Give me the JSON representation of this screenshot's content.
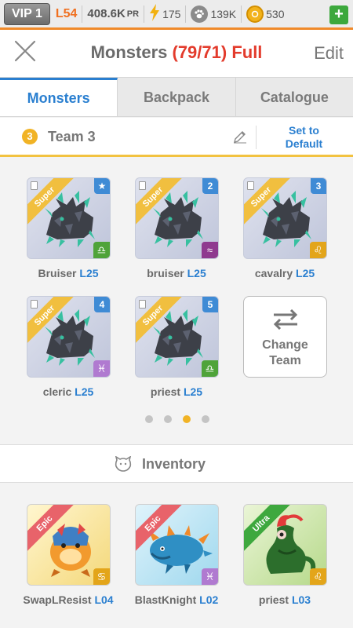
{
  "statusbar": {
    "vip": "VIP 1",
    "level": "L54",
    "power": "408.6K",
    "power_unit": "PR",
    "energy": "175",
    "food": "139K",
    "coins": "530",
    "plus": "+"
  },
  "header": {
    "title": "Monsters",
    "count": "(79/71) Full",
    "edit": "Edit"
  },
  "tabs": [
    "Monsters",
    "Backpack",
    "Catalogue"
  ],
  "team": {
    "number": "3",
    "name": "Team 3",
    "set_default_line1": "Set to",
    "set_default_line2": "Default"
  },
  "team_monsters": [
    {
      "name": "Bruiser",
      "level": "L25",
      "rarity": "Super",
      "slot": "★",
      "element": "♎",
      "element_color": "#4fa33a"
    },
    {
      "name": "bruiser",
      "level": "L25",
      "rarity": "Super",
      "slot": "2",
      "element": "≈",
      "element_color": "#8f3a8f"
    },
    {
      "name": "cavalry",
      "level": "L25",
      "rarity": "Super",
      "slot": "3",
      "element": "♌",
      "element_color": "#e3a51a"
    },
    {
      "name": "cleric",
      "level": "L25",
      "rarity": "Super",
      "slot": "4",
      "element": "♓",
      "element_color": "#b07ad0"
    },
    {
      "name": "priest",
      "level": "L25",
      "rarity": "Super",
      "slot": "5",
      "element": "♎",
      "element_color": "#4fa33a"
    }
  ],
  "change_team": {
    "line1": "Change",
    "line2": "Team"
  },
  "pager": {
    "total": 4,
    "active": 3
  },
  "inventory": {
    "label": "Inventory",
    "items": [
      {
        "name": "SwapLResist",
        "level": "L04",
        "rarity": "Epic",
        "ribbon_color": "#e8636a",
        "element": "♋",
        "element_color": "#e3a51a"
      },
      {
        "name": "BlastKnight",
        "level": "L02",
        "rarity": "Epic",
        "ribbon_color": "#e8636a",
        "element": "♓",
        "element_color": "#b07ad0"
      },
      {
        "name": "priest",
        "level": "L03",
        "rarity": "Ultra",
        "ribbon_color": "#3ea83e",
        "element": "♌",
        "element_color": "#e3a51a"
      }
    ]
  }
}
